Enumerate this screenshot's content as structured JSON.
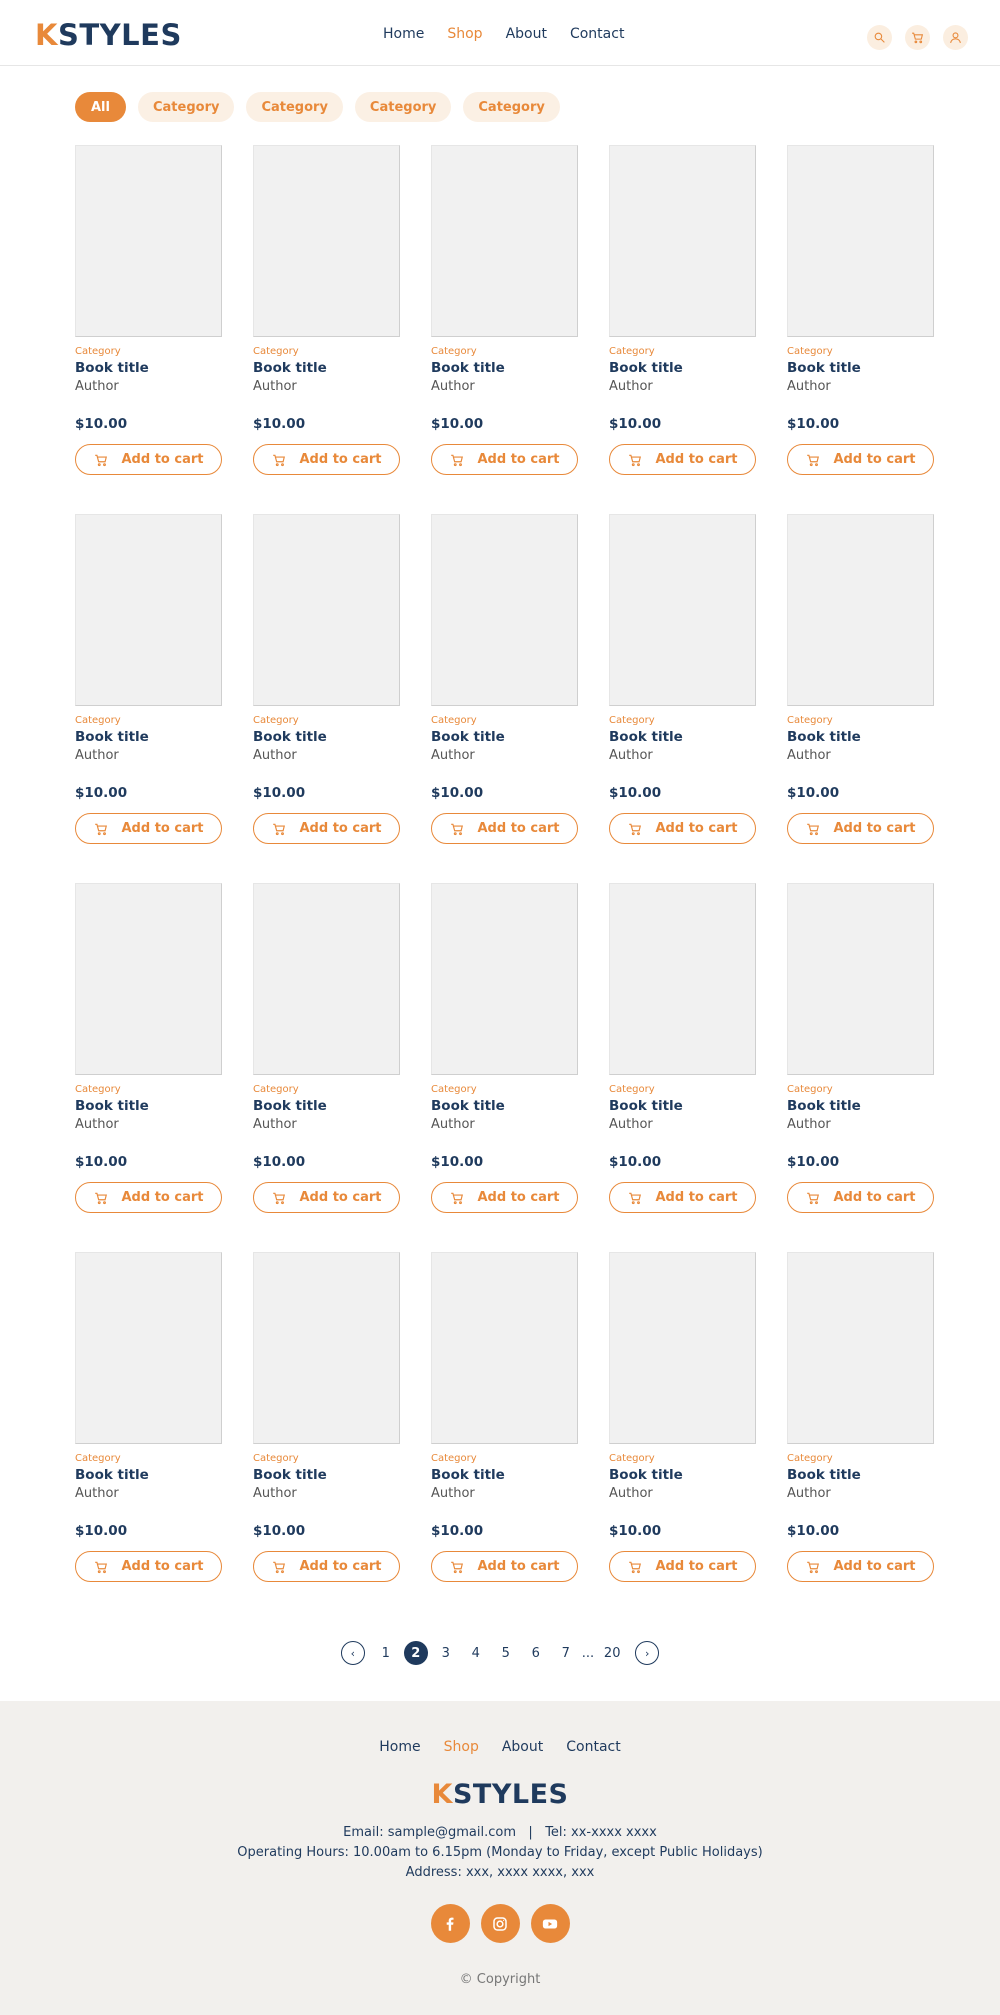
{
  "brand": {
    "logo_k": "K",
    "logo_rest": "STYLES"
  },
  "nav": [
    {
      "label": "Home",
      "active": false
    },
    {
      "label": "Shop",
      "active": true
    },
    {
      "label": "About",
      "active": false
    },
    {
      "label": "Contact",
      "active": false
    }
  ],
  "header_icons": [
    "search-icon",
    "cart-icon",
    "user-icon"
  ],
  "filters": [
    "All",
    "Category",
    "Category",
    "Category",
    "Category"
  ],
  "product": {
    "category": "Category",
    "title": "Book title",
    "author": "Author",
    "price": "$10.00",
    "button": "Add to cart"
  },
  "product_count": 20,
  "pagination": {
    "pages": [
      "1",
      "2",
      "3",
      "4",
      "5",
      "6",
      "7"
    ],
    "current": "2",
    "ellipsis": "...",
    "last": "20",
    "prev_icon": "‹",
    "next_icon": "›"
  },
  "footer": {
    "nav": [
      {
        "label": "Home",
        "active": false
      },
      {
        "label": "Shop",
        "active": true
      },
      {
        "label": "About",
        "active": false
      },
      {
        "label": "Contact",
        "active": false
      }
    ],
    "contact_line": "Email: sample@gmail.com   |   Tel: xx-xxxx xxxx",
    "hours_line": "Operating Hours: 10.00am to 6.15pm (Monday to Friday, except Public Holidays)",
    "address_line": "Address: xxx, xxxx xxxx, xxx",
    "social": [
      "facebook-icon",
      "instagram-icon",
      "youtube-icon"
    ],
    "copyright": "© Copyright"
  },
  "colors": {
    "accent": "#e8893a",
    "navy": "#1f3a5d",
    "footer_bg": "#f2f0ed"
  }
}
